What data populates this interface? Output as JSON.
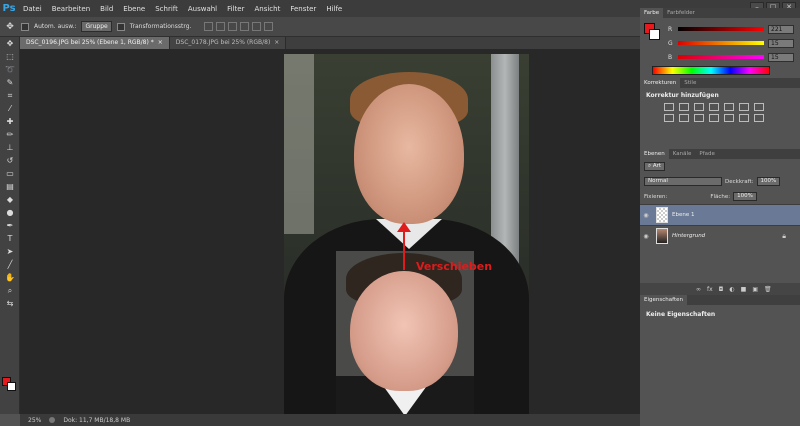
{
  "app": {
    "logo": "Ps"
  },
  "menu": [
    "Datei",
    "Bearbeiten",
    "Bild",
    "Ebene",
    "Schrift",
    "Auswahl",
    "Filter",
    "Ansicht",
    "Fenster",
    "Hilfe"
  ],
  "window_controls": [
    "–",
    "□",
    "✕"
  ],
  "options": {
    "auto_select_label": "Autom. ausw.:",
    "auto_select_value": "Gruppe",
    "transform_label": "Transformationsstrg."
  },
  "tabs": [
    {
      "label": "DSC_0196.JPG bei 25% (Ebene 1, RGB/8) *",
      "close": "×",
      "active": true
    },
    {
      "label": "DSC_0178.JPG bei 25% (RGB/8)",
      "close": "×",
      "active": false
    }
  ],
  "canvas": {
    "annotation": "Verschieben"
  },
  "status": {
    "zoom": "25%",
    "doc": "Dok: 11,7 MB/18,8 MB"
  },
  "color_panel": {
    "tabs": [
      "Farbe",
      "Farbfelder"
    ],
    "sliders": [
      {
        "letter": "R",
        "value": "221",
        "gradient": "linear-gradient(90deg,#000,#f00)"
      },
      {
        "letter": "G",
        "value": "15",
        "gradient": "linear-gradient(90deg,#d00,#ff0)"
      },
      {
        "letter": "B",
        "value": "15",
        "gradient": "linear-gradient(90deg,#d00,#f0f)"
      }
    ],
    "foreground": "#e8191c",
    "background": "#ffffff"
  },
  "adjustments": {
    "tabs": [
      "Korrekturen",
      "Stile"
    ],
    "title": "Korrektur hinzufügen"
  },
  "layers": {
    "tabs": [
      "Ebenen",
      "Kanäle",
      "Pfade"
    ],
    "filter": "Art",
    "blend_mode": "Normal",
    "opacity_label": "Deckkraft:",
    "opacity": "100%",
    "lock_label": "Fixieren:",
    "fill_label": "Fläche:",
    "fill": "100%",
    "items": [
      {
        "name": "Ebene 1",
        "selected": true
      },
      {
        "name": "Hintergrund",
        "selected": false,
        "locked": true
      }
    ],
    "footer_icons": [
      "∞",
      "fx",
      "◘",
      "◐",
      "■",
      "▣",
      "🗑"
    ]
  },
  "properties": {
    "tab": "Eigenschaften",
    "message": "Keine Eigenschaften"
  }
}
